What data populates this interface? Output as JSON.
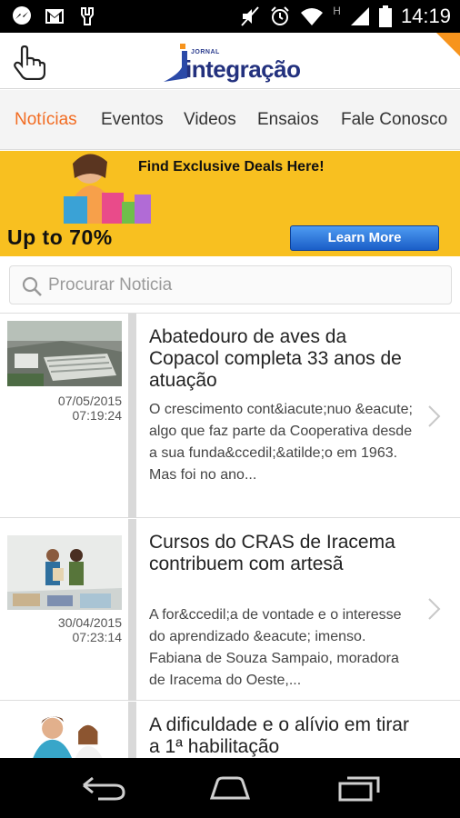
{
  "status_bar": {
    "time": "14:19",
    "icons": [
      "messenger-icon",
      "gmail-icon",
      "usb-debug-icon",
      "mute-icon",
      "alarm-icon",
      "wifi-icon",
      "hspa-icon",
      "signal-icon",
      "battery-icon"
    ],
    "network_label": "H"
  },
  "header": {
    "logo_small": "JORNAL",
    "logo_text": "integração",
    "brand_color": "#23317e",
    "accent_color": "#f7941d"
  },
  "tabs": [
    {
      "label": "Notícias",
      "active": true
    },
    {
      "label": "Eventos",
      "active": false
    },
    {
      "label": "Videos",
      "active": false
    },
    {
      "label": "Ensaios",
      "active": false
    },
    {
      "label": "Fale Conosco",
      "active": false
    }
  ],
  "ad": {
    "title": "Find Exclusive Deals Here!",
    "offer": "Up to 70%",
    "button": "Learn More"
  },
  "search": {
    "placeholder": "Procurar Noticia"
  },
  "news": [
    {
      "title": "Abatedouro de aves da Copacol completa 33 anos de atuação",
      "date": "07/05/2015",
      "time": "07:19:24",
      "excerpt": "O crescimento cont&iacute;nuo &eacute; algo que faz parte da Cooperativa desde a sua funda&ccedil;&atilde;o em 1963. Mas foi no ano...",
      "thumb_icon": "factory-photo"
    },
    {
      "title": "Cursos do CRAS de Iracema contribuem com artesã",
      "date": "30/04/2015",
      "time": "07:23:14",
      "excerpt": "A for&ccedil;a de vontade e o interesse do aprendizado &eacute; imenso. Fabiana de Souza Sampaio, moradora de Iracema do Oeste,...",
      "thumb_icon": "crafts-photo"
    },
    {
      "title": "A dificuldade e o alívio em tirar a 1ª habilitação",
      "thumb_icon": "students-photo"
    }
  ],
  "nav": [
    "back-icon",
    "home-icon",
    "recents-icon"
  ]
}
